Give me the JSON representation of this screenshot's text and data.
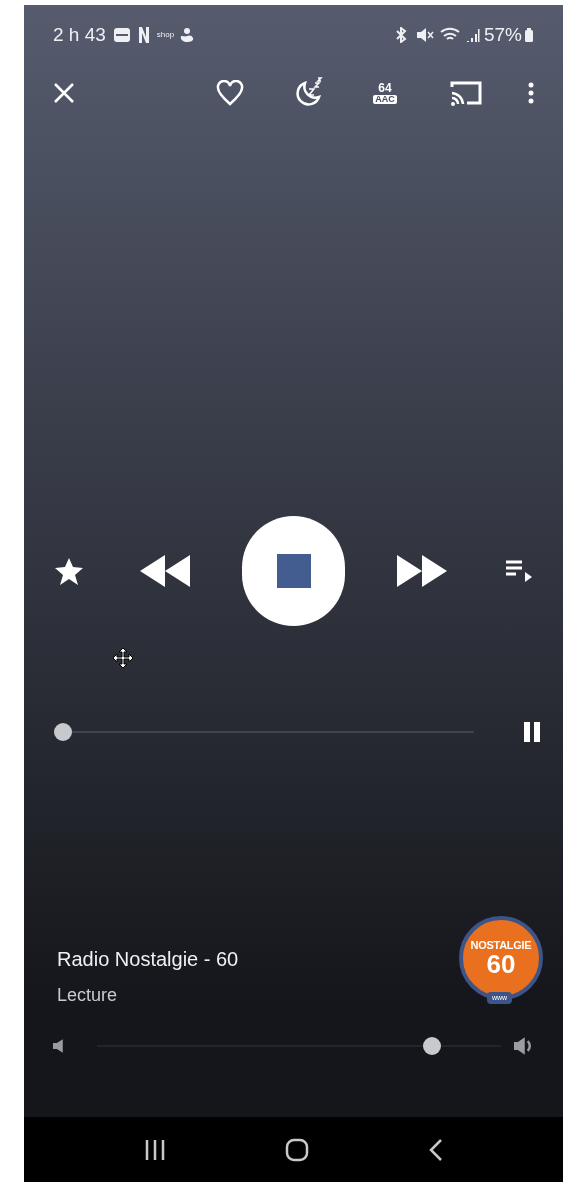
{
  "status_bar": {
    "time": "2 h 43",
    "shop_label": "shop",
    "battery": "57%"
  },
  "toolbar": {
    "bitrate": "64",
    "codec": "AAC"
  },
  "progress": {
    "level": 0
  },
  "station": {
    "name": "Radio Nostalgie - 60",
    "status": "Lecture",
    "logo": {
      "title": "NOSTALGIE",
      "number": "60",
      "badge": "www"
    }
  },
  "volume": {
    "level": 0.845
  }
}
